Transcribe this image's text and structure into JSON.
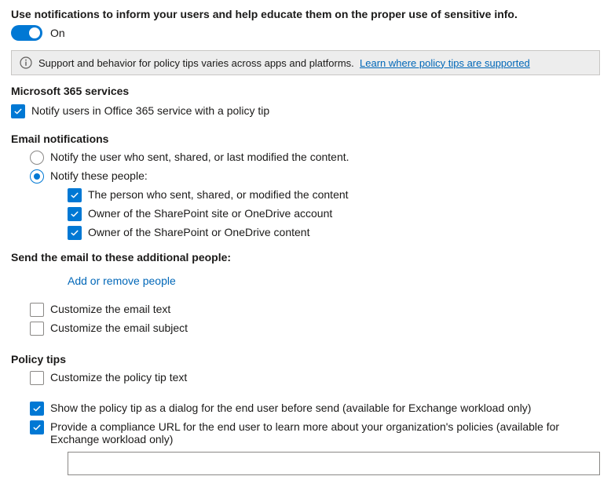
{
  "header": {
    "description": "Use notifications to inform your users and help educate them on the proper use of sensitive info.",
    "toggle_state": "On"
  },
  "info_bar": {
    "text": "Support and behavior for policy tips varies across apps and platforms.",
    "link": "Learn where policy tips are supported"
  },
  "m365": {
    "heading": "Microsoft 365 services",
    "notify_users": "Notify users in Office 365 service with a policy tip"
  },
  "email": {
    "heading": "Email notifications",
    "radio_sender": "Notify the user who sent, shared, or last modified the content.",
    "radio_people": "Notify these people:",
    "cb_person": "The person who sent, shared, or modified the content",
    "cb_owner_site": "Owner of the SharePoint site or OneDrive account",
    "cb_owner_content": "Owner of the SharePoint or OneDrive content",
    "additional_heading": "Send the email to these additional people:",
    "add_remove": "Add or remove people",
    "customize_text": "Customize the email text",
    "customize_subject": "Customize the email subject"
  },
  "tips": {
    "heading": "Policy tips",
    "customize": "Customize the policy tip text",
    "dialog": "Show the policy tip as a dialog for the end user before send (available for Exchange workload only)",
    "compliance_url": "Provide a compliance URL for the end user to learn more about your organization's policies (available for Exchange workload only)",
    "url_value": ""
  }
}
